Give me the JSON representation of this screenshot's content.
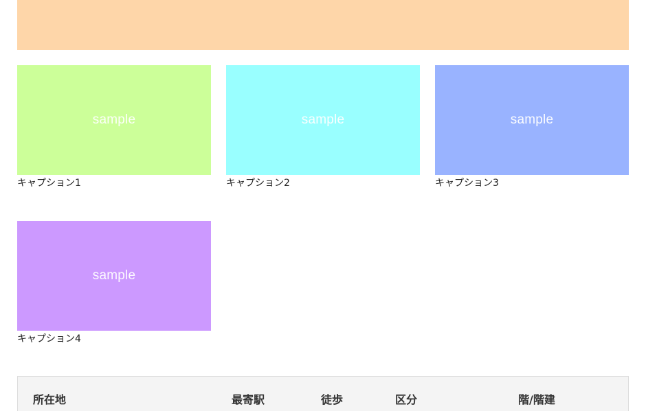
{
  "hero": {
    "color": "#fed6a9"
  },
  "gallery": [
    {
      "image_text": "sample",
      "caption": "キャプション1",
      "color": "#ccff99"
    },
    {
      "image_text": "sample",
      "caption": "キャプション2",
      "color": "#99ffff"
    },
    {
      "image_text": "sample",
      "caption": "キャプション3",
      "color": "#99b3ff"
    },
    {
      "image_text": "sample",
      "caption": "キャプション4",
      "color": "#cc99ff"
    }
  ],
  "table": {
    "headers": [
      "所在地",
      "最寄駅",
      "徒歩",
      "区分",
      "階/階建"
    ]
  }
}
